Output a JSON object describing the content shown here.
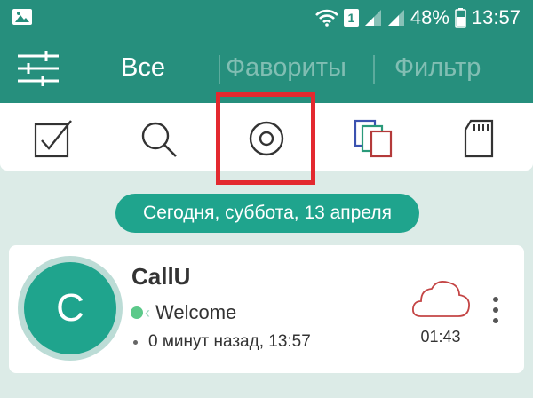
{
  "status_bar": {
    "sim_badge": "1",
    "battery_percent": "48%",
    "time": "13:57"
  },
  "app_bar": {
    "tabs": [
      {
        "label": "Все",
        "active": true
      },
      {
        "label": "Фавориты",
        "active": false
      },
      {
        "label": "Фильтр",
        "active": false
      }
    ]
  },
  "toolbar": {
    "icons": [
      "checkbox-icon",
      "search-icon",
      "record-icon",
      "copy-colors-icon",
      "sd-card-icon"
    ],
    "highlighted": "record-icon",
    "highlight_color": "#e3292f"
  },
  "date_header": "Сегодня, суббота, 13 апреля",
  "calls": [
    {
      "avatar_letter": "C",
      "name": "CallU",
      "message": "Welcome",
      "time": "0 минут назад, 13:57",
      "duration": "01:43",
      "status_icon": "cloud-icon"
    }
  ],
  "colors": {
    "primary": "#268f7d",
    "accent": "#1fa48d",
    "background": "#dcebe7"
  }
}
